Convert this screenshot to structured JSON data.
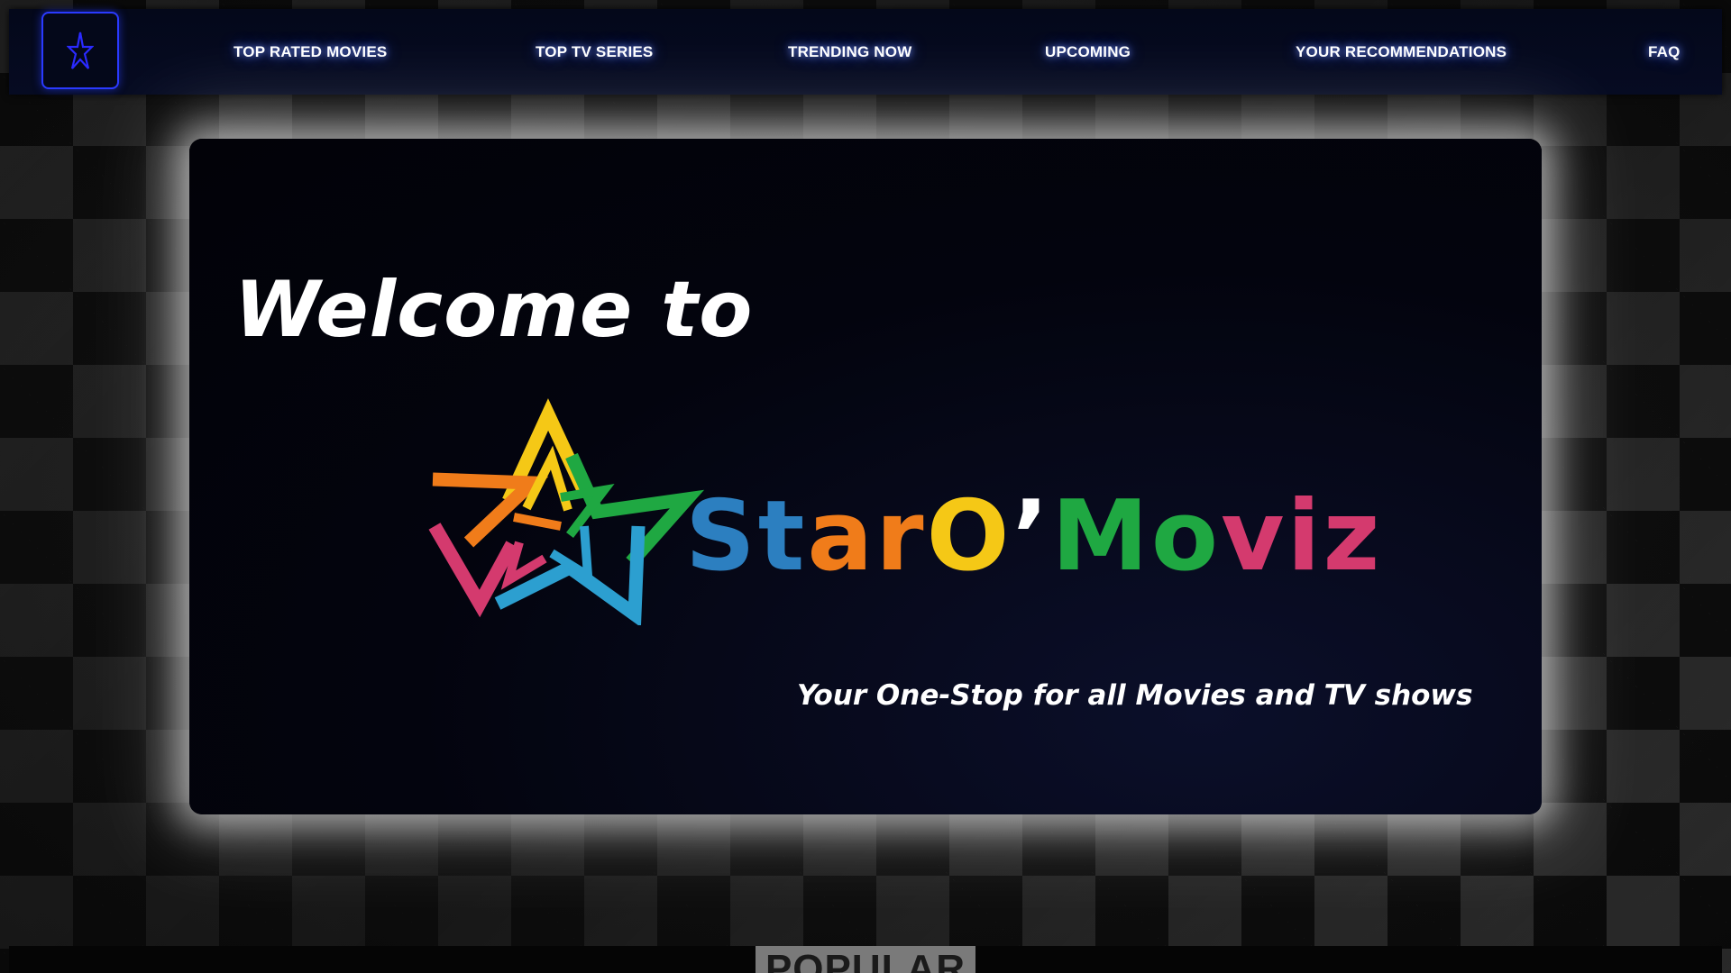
{
  "nav": {
    "logo_icon": "star-logo-icon",
    "items": [
      {
        "label": "TOP RATED MOVIES"
      },
      {
        "label": "TOP TV SERIES"
      },
      {
        "label": "TRENDING NOW"
      },
      {
        "label": "UPCOMING"
      },
      {
        "label": "YOUR RECOMMENDATIONS"
      },
      {
        "label": "FAQ"
      }
    ]
  },
  "hero": {
    "welcome": "Welcome to",
    "brand_parts": [
      {
        "text": "St",
        "color": "#2c7fc0"
      },
      {
        "text": "ar",
        "color": "#f07c1a"
      },
      {
        "text": "O",
        "color": "#f5c816"
      },
      {
        "text": "’",
        "color": "#ffffff"
      },
      {
        "text": "M",
        "color": "#1fa842"
      },
      {
        "text": "o",
        "color": "#1fa842"
      },
      {
        "text": "v",
        "color": "#d43a6e"
      },
      {
        "text": "iz",
        "color": "#d43a6e"
      }
    ],
    "tagline": "Your One-Stop for all Movies and TV shows"
  },
  "section": {
    "heading": "POPULAR"
  },
  "colors": {
    "nav_glow": "#3c5aff",
    "star_yellow": "#f5c816",
    "star_orange": "#f07c1a",
    "star_green": "#1fa842",
    "star_blue": "#2c9fd0",
    "star_pink": "#d43a6e"
  }
}
